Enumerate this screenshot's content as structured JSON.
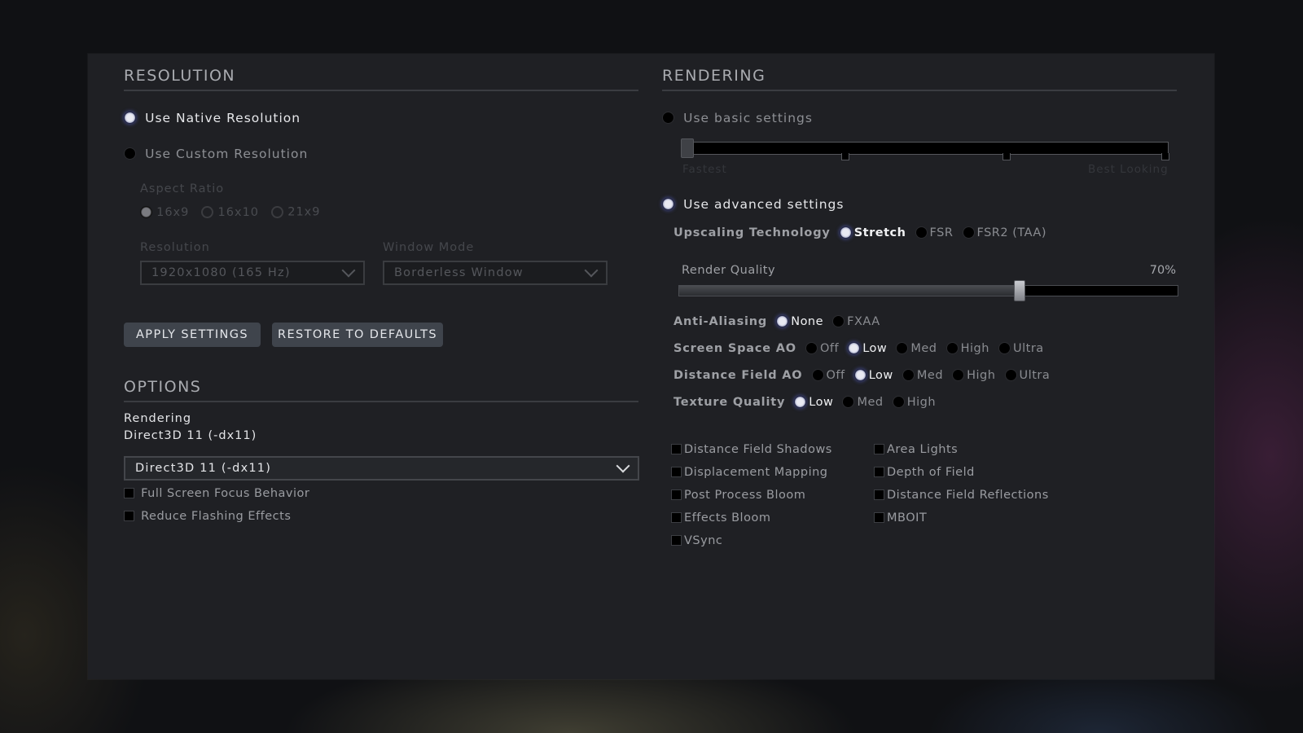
{
  "resolution": {
    "title": "RESOLUTION",
    "native_label": "Use Native Resolution",
    "custom_label": "Use Custom Resolution",
    "mode_selected": "native",
    "aspect_ratio": {
      "label": "Aspect Ratio",
      "options": [
        "16x9",
        "16x10",
        "21x9"
      ],
      "selected": "16x9"
    },
    "resolution_select": {
      "label": "Resolution",
      "value": "1920x1080 (165 Hz)"
    },
    "window_mode_select": {
      "label": "Window Mode",
      "value": "Borderless Window"
    },
    "apply_label": "APPLY SETTINGS",
    "restore_label": "RESTORE TO DEFAULTS"
  },
  "options": {
    "title": "OPTIONS",
    "rendering_label": "Rendering",
    "rendering_current": "Direct3D 11 (-dx11)",
    "rendering_select_value": "Direct3D 11 (-dx11)",
    "checkboxes": [
      {
        "label": "Full Screen Focus Behavior",
        "checked": false
      },
      {
        "label": "Reduce Flashing Effects",
        "checked": false
      }
    ]
  },
  "rendering": {
    "title": "RENDERING",
    "basic_label": "Use basic settings",
    "basic_slider": {
      "min_label": "Fastest",
      "max_label": "Best Looking",
      "steps": 4,
      "value_step": 0
    },
    "advanced_label": "Use advanced settings",
    "mode_selected": "advanced",
    "upscaling": {
      "label": "Upscaling Technology",
      "options": [
        "Stretch",
        "FSR",
        "FSR2 (TAA)"
      ],
      "selected": "Stretch"
    },
    "render_quality": {
      "label": "Render Quality",
      "value_text": "70%",
      "value_percent": 70
    },
    "anti_aliasing": {
      "label": "Anti-Aliasing",
      "options": [
        "None",
        "FXAA"
      ],
      "selected": "None"
    },
    "ssao": {
      "label": "Screen Space AO",
      "options": [
        "Off",
        "Low",
        "Med",
        "High",
        "Ultra"
      ],
      "selected": "Low"
    },
    "dfao": {
      "label": "Distance Field AO",
      "options": [
        "Off",
        "Low",
        "Med",
        "High",
        "Ultra"
      ],
      "selected": "Low"
    },
    "texture_quality": {
      "label": "Texture Quality",
      "options": [
        "Low",
        "Med",
        "High"
      ],
      "selected": "Low"
    },
    "checkboxes_left": [
      {
        "label": "Distance Field Shadows",
        "checked": false
      },
      {
        "label": "Displacement Mapping",
        "checked": false
      },
      {
        "label": "Post Process Bloom",
        "checked": false
      },
      {
        "label": "Effects Bloom",
        "checked": false
      },
      {
        "label": "VSync",
        "checked": false
      }
    ],
    "checkboxes_right": [
      {
        "label": "Area Lights",
        "checked": false
      },
      {
        "label": "Depth of Field",
        "checked": false
      },
      {
        "label": "Distance Field Reflections",
        "checked": false
      },
      {
        "label": "MBOIT",
        "checked": false
      }
    ]
  }
}
